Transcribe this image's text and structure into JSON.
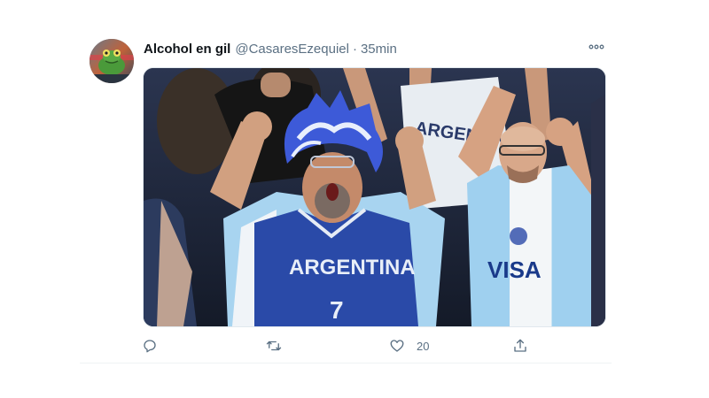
{
  "tweet": {
    "display_name": "Alcohol en gil",
    "handle": "@CasaresEzequiel",
    "separator": "·",
    "time": "35min",
    "avatar_icon": "frog-avatar",
    "more_icon": "more-options-icon",
    "media": {
      "jersey_main_text": "ARGENTINA",
      "jersey_main_number": "7",
      "jersey_back_text": "ARGENTINA",
      "jersey_sponsor": "VISA"
    },
    "actions": {
      "reply_icon": "reply-icon",
      "retweet_icon": "retweet-icon",
      "like_icon": "heart-icon",
      "like_count": "20",
      "share_icon": "share-icon"
    }
  },
  "colors": {
    "name": "#0f1419",
    "secondary": "#5b7083",
    "jersey_blue": "#2a4aa8",
    "albiceleste": "#8fc6ea"
  }
}
